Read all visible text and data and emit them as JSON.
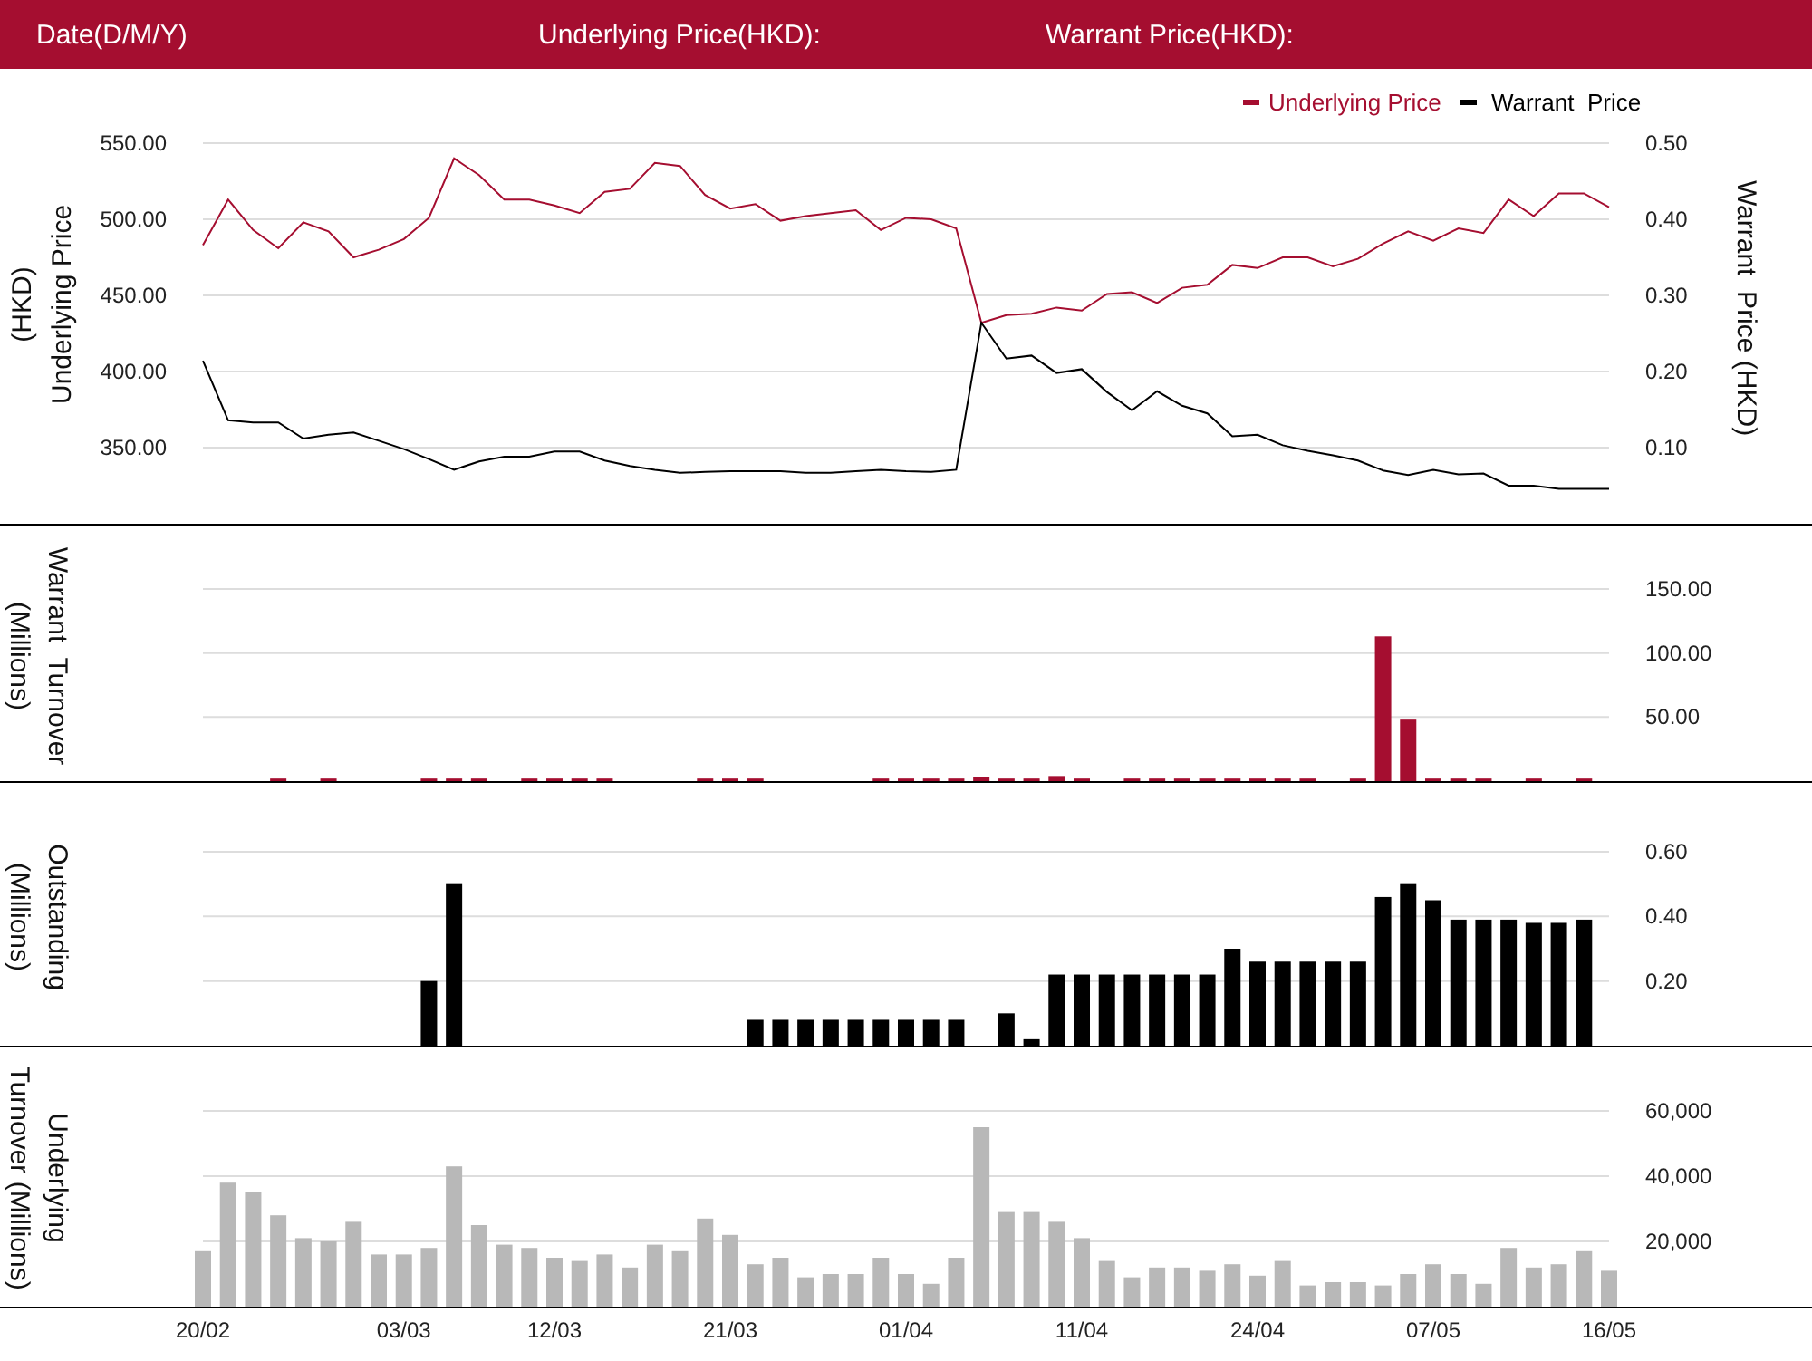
{
  "header": {
    "labels": [
      "Date(D/M/Y)",
      "Underlying Price(HKD):",
      "Warrant Price(HKD):"
    ]
  },
  "price_chart": {
    "chart_data": {
      "type": "line",
      "ylabel": "Underlying Price\n(HKD)",
      "y2label": "Warrant  Price (HKD)",
      "ylim": [
        300,
        550
      ],
      "y2lim": [
        0,
        0.5
      ],
      "grid": true,
      "legend": "top-right",
      "yticks": [
        {
          "value": 350,
          "label": "350.00"
        },
        {
          "value": 400,
          "label": "400.00"
        },
        {
          "value": 450,
          "label": "450.00"
        },
        {
          "value": 500,
          "label": "500.00"
        },
        {
          "value": 550,
          "label": "550.00"
        }
      ],
      "y2ticks": [
        {
          "value": 0.1,
          "label": "0.10"
        },
        {
          "value": 0.2,
          "label": "0.20"
        },
        {
          "value": 0.3,
          "label": "0.30"
        },
        {
          "value": 0.4,
          "label": "0.40"
        },
        {
          "value": 0.5,
          "label": "0.50"
        }
      ],
      "series": [
        {
          "name": "Underlying Price",
          "color": "#a50e30",
          "values": [
            483,
            513,
            493,
            481,
            498,
            492,
            475,
            480,
            487,
            501,
            540,
            529,
            513,
            513,
            509,
            504,
            518,
            520,
            537,
            535,
            516,
            507,
            510,
            499,
            502,
            504,
            506,
            493,
            501,
            500,
            494,
            432,
            437,
            438,
            442,
            440,
            451,
            452,
            445,
            455,
            457,
            470,
            468,
            475,
            475,
            469,
            474,
            484,
            492,
            486,
            494,
            491,
            513,
            502,
            517,
            517,
            508
          ]
        },
        {
          "name": "Warrant  Price",
          "color": "#000000",
          "axis": "y2",
          "values": [
            0.214,
            0.136,
            0.133,
            0.133,
            0.112,
            0.117,
            0.12,
            0.109,
            0.098,
            0.085,
            0.071,
            0.082,
            0.088,
            0.088,
            0.095,
            0.095,
            0.083,
            0.076,
            0.071,
            0.067,
            0.068,
            0.069,
            0.069,
            0.069,
            0.067,
            0.067,
            0.069,
            0.071,
            0.069,
            0.068,
            0.071,
            0.264,
            0.217,
            0.221,
            0.198,
            0.203,
            0.173,
            0.149,
            0.174,
            0.155,
            0.145,
            0.115,
            0.117,
            0.103,
            0.096,
            0.09,
            0.083,
            0.07,
            0.064,
            0.071,
            0.065,
            0.066,
            0.05,
            0.05,
            0.046,
            0.046,
            0.046
          ]
        }
      ]
    }
  },
  "bar_panels": [
    {
      "chart_data": {
        "type": "bar",
        "ylabel": "Warrant  Turnover\n(Millions)",
        "ylim": [
          0,
          150
        ],
        "grid": true,
        "yticks": [
          {
            "value": 50,
            "label": "50.00"
          },
          {
            "value": 100,
            "label": "100.00"
          },
          {
            "value": 150,
            "label": "150.00"
          }
        ],
        "series": [
          {
            "color": "#a50e30",
            "values": [
              null,
              null,
              null,
              2,
              null,
              2,
              null,
              null,
              null,
              2,
              2,
              2,
              null,
              2,
              2,
              2,
              2,
              null,
              null,
              null,
              2,
              2,
              2,
              null,
              null,
              null,
              null,
              2,
              2,
              2,
              2,
              3,
              2,
              2,
              4,
              2,
              null,
              2,
              2,
              2,
              2,
              2,
              2,
              2,
              2,
              null,
              2,
              113,
              48,
              2,
              2,
              2,
              null,
              2,
              null,
              2,
              null
            ]
          }
        ]
      }
    },
    {
      "chart_data": {
        "type": "bar",
        "ylabel": "Outstanding\n(Millions)",
        "ylim": [
          0,
          0.6
        ],
        "grid": true,
        "yticks": [
          {
            "value": 0.2,
            "label": "0.20"
          },
          {
            "value": 0.4,
            "label": "0.40"
          },
          {
            "value": 0.6,
            "label": "0.60"
          }
        ],
        "series": [
          {
            "color": "#000000",
            "values": [
              null,
              null,
              null,
              null,
              null,
              null,
              null,
              null,
              null,
              0.2,
              0.5,
              null,
              null,
              null,
              null,
              null,
              null,
              null,
              null,
              null,
              null,
              null,
              0.08,
              0.08,
              0.08,
              0.08,
              0.08,
              0.08,
              0.08,
              0.08,
              0.08,
              null,
              0.1,
              0.02,
              0.22,
              0.22,
              0.22,
              0.22,
              0.22,
              0.22,
              0.22,
              0.3,
              0.26,
              0.26,
              0.26,
              0.26,
              0.26,
              0.46,
              0.5,
              0.45,
              0.39,
              0.39,
              0.39,
              0.38,
              0.38,
              0.39,
              null
            ]
          }
        ]
      }
    },
    {
      "chart_data": {
        "type": "bar",
        "ylabel": "Underlying\nTurnover (Millions)",
        "ylim": [
          0,
          60000
        ],
        "grid": true,
        "yticks": [
          {
            "value": 20000,
            "label": "20,000"
          },
          {
            "value": 40000,
            "label": "40,000"
          },
          {
            "value": 60000,
            "label": "60,000"
          }
        ],
        "categories": [
          "20/02",
          null,
          null,
          null,
          null,
          null,
          null,
          null,
          "03/03",
          null,
          null,
          null,
          null,
          null,
          "12/03",
          null,
          null,
          null,
          null,
          null,
          null,
          "21/03",
          null,
          null,
          null,
          null,
          null,
          null,
          "01/04",
          null,
          null,
          null,
          null,
          null,
          null,
          "11/04",
          null,
          null,
          null,
          null,
          null,
          null,
          "24/04",
          null,
          null,
          null,
          null,
          null,
          null,
          "07/05",
          null,
          null,
          null,
          null,
          null,
          null,
          "16/05"
        ],
        "series": [
          {
            "color": "#b8b8b8",
            "values": [
              17000,
              38000,
              35000,
              28000,
              21000,
              20000,
              26000,
              16000,
              16000,
              18000,
              43000,
              25000,
              19000,
              18000,
              15000,
              14000,
              16000,
              12000,
              19000,
              17000,
              27000,
              22000,
              13000,
              15000,
              9000,
              10000,
              10000,
              15000,
              10000,
              7000,
              15000,
              55000,
              29000,
              29000,
              26000,
              21000,
              14000,
              9000,
              12000,
              12000,
              11000,
              13000,
              9500,
              14000,
              6500,
              7500,
              7500,
              6500,
              10000,
              13000,
              10000,
              7000,
              18000,
              12000,
              13000,
              17000,
              11000
            ]
          }
        ]
      }
    }
  ]
}
